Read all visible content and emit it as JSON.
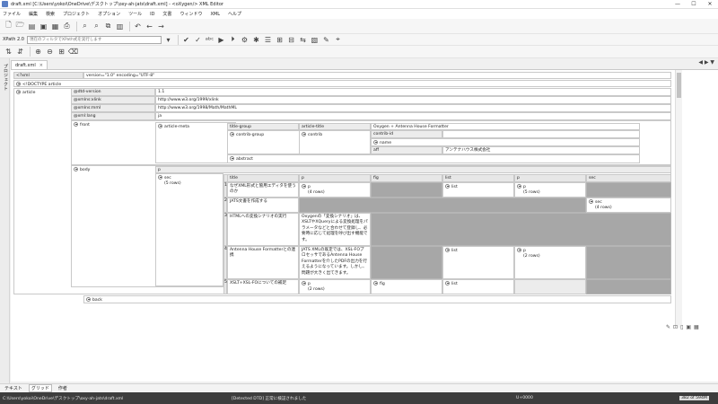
{
  "window": {
    "title": "draft.xml [C:\\Users\\yokoi\\OneDrive\\デスクトップ\\oxy-ah-jats\\draft.xml] - <oXygen/> XML Editor",
    "min": "—",
    "max": "☐",
    "close": "✕"
  },
  "menu": [
    "ファイル",
    "編集",
    "検索",
    "プロジェクト",
    "オプション",
    "ツール",
    "ID",
    "文書",
    "ウィンドウ",
    "XML",
    "ヘルプ"
  ],
  "xpath": {
    "label": "XPath 2.0",
    "placeholder": "現在のフィルタでXPath式を実行します"
  },
  "left_panel": {
    "label": "プロジェクト"
  },
  "tab": {
    "name": "draft.xml",
    "close": "×"
  },
  "tab_nav": "◀ ▶ ▼",
  "grid": {
    "row_xml": {
      "name": "<?xml",
      "value": "version=\"1.0\" encoding=\"UTF-8\""
    },
    "doctype": "<!DOCTYPE article",
    "article": "article",
    "attrs": [
      {
        "name": "@dtd-version",
        "value": "1.1"
      },
      {
        "name": "@xmlns:xlink",
        "value": "http://www.w3.org/1999/xlink"
      },
      {
        "name": "@xmlns:mml",
        "value": "http://www.w3.org/1998/Math/MathML"
      },
      {
        "name": "@xml:lang",
        "value": "ja"
      }
    ],
    "front": "front",
    "article_meta": "article-meta",
    "title_group": "title-group",
    "article_title": "article-title",
    "article_title_value": "Oxygen + Antenna House Formatter",
    "contrib_group": "contrib-group",
    "contrib": "contrib",
    "contrib_id": "contrib-id",
    "name": "name",
    "aff": "aff",
    "aff_value": "アンテナハウス株式会社",
    "abstract": "abstract",
    "body": "body",
    "p": "p",
    "sec": "sec",
    "sec_rows": "(5 rows)",
    "columns": [
      "title",
      "p",
      "fig",
      "list",
      "p",
      "sec"
    ],
    "rows": [
      {
        "num": "1",
        "title": "なぜXML形式と箇用エディタを使うのか",
        "p": "p",
        "p_rows": "(4 rows)",
        "list": "list",
        "p2": "p",
        "p2_rows": "(5 rows)"
      },
      {
        "num": "2",
        "title": "JATS文書を作成する",
        "sec": "sec",
        "sec_rows": "(4 rows)"
      },
      {
        "num": "3",
        "title": "HTMLへの変換シナリオの実行",
        "p_text": "Oxygenの「変換シナリオ」は、XSLTやXQueryによる変換処理をパラメータなどと合わせて登録し、必要時に応じて処理を呼び出す機能です。"
      },
      {
        "num": "4",
        "title": "Antenna House Formatterとの連携",
        "p_text": "JATS XMLの既定では、XSL-FOプロセッサであるAntenna House Formatterを介したPDFの出力を行えるようになっています。しかし、問題が大きく出てきます。",
        "list": "list",
        "p2": "p",
        "p2_rows": "(2 rows)"
      },
      {
        "num": "5",
        "title": "XSLT+XSL-FOについての補足",
        "p": "p",
        "p_rows": "(2 rows)",
        "fig": "fig",
        "list": "list"
      }
    ],
    "back": "back"
  },
  "bottom_tabs": [
    "テキスト",
    "グリッド",
    "作者"
  ],
  "status": {
    "path": "C:\\Users\\yokoi\\OneDrive\\デスクトップ\\oxy-ah-jats\\draft.xml",
    "message": "[Detected DTD] 正常に検証されました",
    "position": "U+0000",
    "memory": "382 of 594M"
  }
}
